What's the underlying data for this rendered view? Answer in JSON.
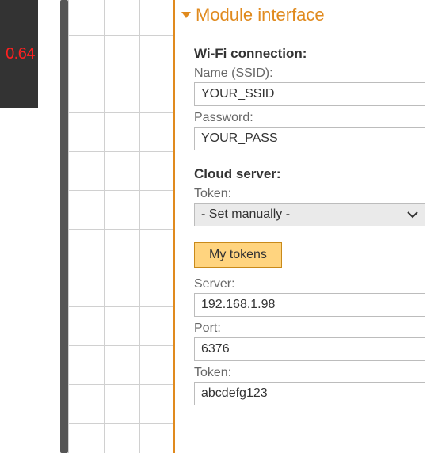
{
  "readout": {
    "value": "0.64"
  },
  "section": {
    "title": "Module interface",
    "wifi": {
      "heading": "Wi-Fi connection:",
      "ssid_label": "Name (SSID):",
      "ssid_value": "YOUR_SSID",
      "pass_label": "Password:",
      "pass_value": "YOUR_PASS"
    },
    "cloud": {
      "heading": "Cloud server:",
      "token_label": "Token:",
      "token_select": "- Set manually -",
      "my_tokens_btn": "My tokens",
      "server_label": "Server:",
      "server_value": "192.168.1.98",
      "port_label": "Port:",
      "port_value": "6376",
      "token2_label": "Token:",
      "token2_value": "abcdefg123"
    }
  }
}
